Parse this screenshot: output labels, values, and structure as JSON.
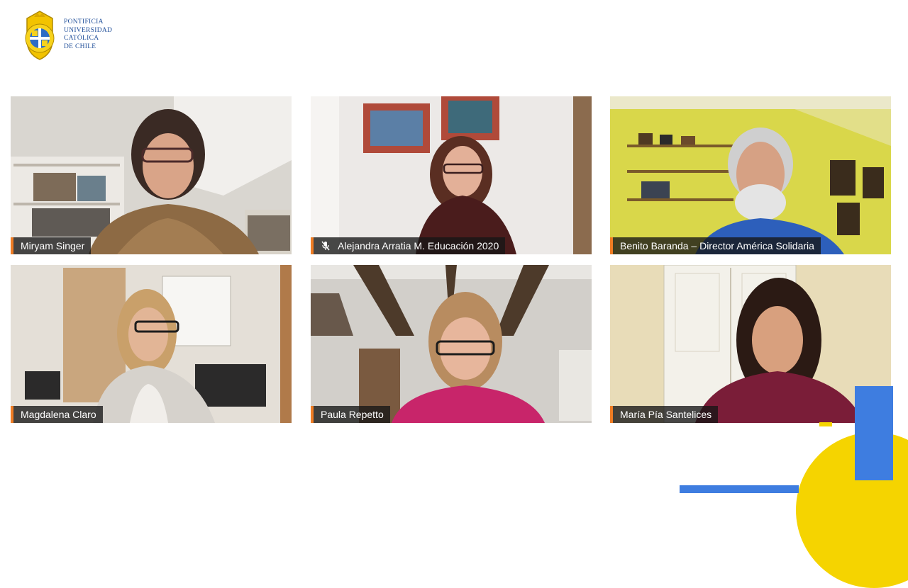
{
  "institution": {
    "lines": [
      "PONTIFICIA",
      "UNIVERSIDAD",
      "CATÓLICA",
      "DE CHILE"
    ]
  },
  "participants": [
    {
      "name": "Miryam Singer",
      "muted": false
    },
    {
      "name": "Alejandra Arratia M. Educación 2020",
      "muted": true
    },
    {
      "name": "Benito Baranda – Director América Solidaria",
      "muted": false
    },
    {
      "name": "Magdalena Claro",
      "muted": false
    },
    {
      "name": "Paula Repetto",
      "muted": false
    },
    {
      "name": "María Pía Santelices",
      "muted": false
    }
  ],
  "colors": {
    "accent_orange": "#f07d24",
    "deco_yellow": "#f5d400",
    "deco_blue": "#3e7de0",
    "brand_blue": "#1f4e99"
  }
}
